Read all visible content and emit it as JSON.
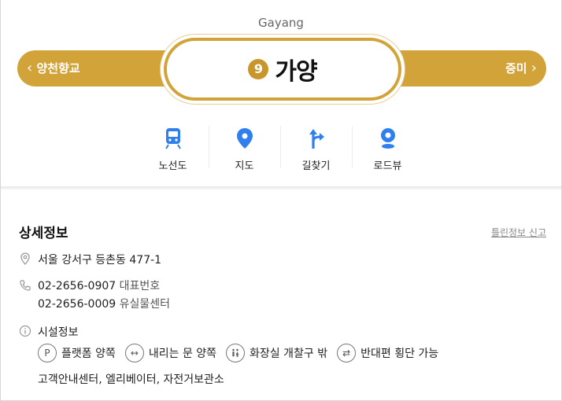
{
  "header": {
    "station_en": "Gayang",
    "line_number": "9",
    "station_name": "가양",
    "prev_station": "양천향교",
    "next_station": "증미",
    "line_color": "#d1a338"
  },
  "actions": [
    {
      "label": "노선도",
      "icon": "train-icon"
    },
    {
      "label": "지도",
      "icon": "map-pin-icon"
    },
    {
      "label": "길찾기",
      "icon": "directions-icon"
    },
    {
      "label": "로드뷰",
      "icon": "roadview-icon"
    }
  ],
  "details": {
    "title": "상세정보",
    "report_link": "틀린정보 신고",
    "address": "서울 강서구 등촌동 477-1",
    "phones": [
      {
        "number": "02-2656-0907",
        "kind": "대표번호"
      },
      {
        "number": "02-2656-0009",
        "kind": "유실물센터"
      }
    ],
    "facilities_title": "시설정보",
    "facilities": [
      {
        "label": "플랫폼 양쪽",
        "icon": "parking-platform-icon"
      },
      {
        "label": "내리는 문 양쪽",
        "icon": "both-doors-icon"
      },
      {
        "label": "화장실 개찰구 밖",
        "icon": "restroom-icon"
      },
      {
        "label": "반대편 횡단 가능",
        "icon": "cross-over-icon"
      }
    ],
    "facilities_extra": "고객안내센터, 엘리베이터, 자전거보관소"
  }
}
